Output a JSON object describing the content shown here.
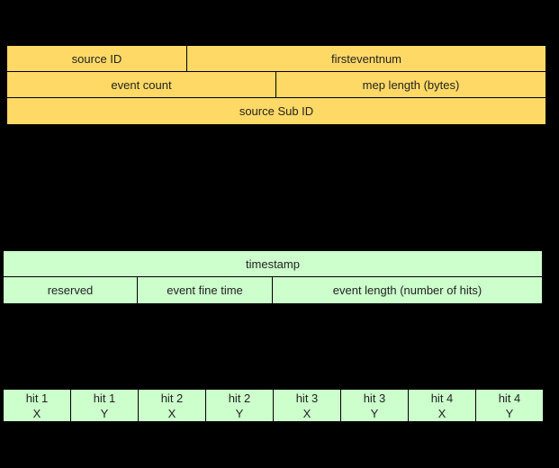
{
  "colors": {
    "header_block": "#FFD966",
    "event_block": "#CCFFCC",
    "background": "#000000"
  },
  "header_block": {
    "rows": [
      [
        "source ID",
        "firsteventnum"
      ],
      [
        "event count",
        "mep length (bytes)"
      ],
      [
        "source Sub ID"
      ]
    ]
  },
  "event_block": {
    "rows": [
      [
        "timestamp"
      ],
      [
        "reserved",
        "event fine time",
        "event length (number of hits)"
      ]
    ]
  },
  "hits_block": {
    "cells": [
      {
        "hit": "hit 1",
        "axis": "X"
      },
      {
        "hit": "hit 1",
        "axis": "Y"
      },
      {
        "hit": "hit 2",
        "axis": "X"
      },
      {
        "hit": "hit 2",
        "axis": "Y"
      },
      {
        "hit": "hit 3",
        "axis": "X"
      },
      {
        "hit": "hit 3",
        "axis": "Y"
      },
      {
        "hit": "hit 4",
        "axis": "X"
      },
      {
        "hit": "hit 4",
        "axis": "Y"
      }
    ]
  }
}
